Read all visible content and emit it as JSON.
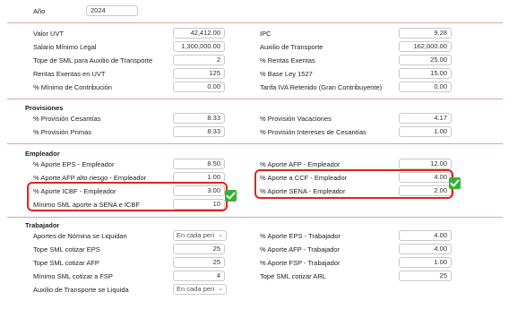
{
  "year": {
    "label": "Año",
    "value": "2024"
  },
  "general": {
    "left": [
      {
        "label": "Valor UVT",
        "value": "42,412.00"
      },
      {
        "label": "Salario Mínimo Legal",
        "value": "1,300,000.00"
      },
      {
        "label": "Tope de SML para Auxilio de Transporte",
        "value": "2"
      },
      {
        "label": "Rentas Exentas en UVT",
        "value": "125"
      },
      {
        "label": "% Mínimo de Contribución",
        "value": "0.00"
      }
    ],
    "right": [
      {
        "label": "IPC",
        "value": "9.28"
      },
      {
        "label": "Auxilio de Transporte",
        "value": "162,000.00"
      },
      {
        "label": "% Rentas Exentas",
        "value": "25.00"
      },
      {
        "label": "% Base Ley 1527",
        "value": "15.00"
      },
      {
        "label": "Tarifa IVA Retenido (Gran Contribuyente)",
        "value": "0.00"
      }
    ]
  },
  "provisiones": {
    "title": "Provisiones",
    "left": [
      {
        "label": "% Provisión Cesantías",
        "value": "8.33"
      },
      {
        "label": "% Provisión Primas",
        "value": "8.33"
      }
    ],
    "right": [
      {
        "label": "% Provisión Vacaciones",
        "value": "4.17"
      },
      {
        "label": "% Provisión Intereses de Cesantías",
        "value": "1.00"
      }
    ]
  },
  "empleador": {
    "title": "Empleador",
    "left": [
      {
        "label": "% Aporte EPS - Empleador",
        "value": "8.50"
      },
      {
        "label": "% Aporte AFP alto riesgo - Empleador",
        "value": "1.00"
      },
      {
        "label": "% Aporte ICBF - Empleador",
        "value": "3.00"
      },
      {
        "label": "Mínimo SML aporte a SENA e ICBF",
        "value": "10"
      }
    ],
    "right": [
      {
        "label": "% Aporte AFP - Empleador",
        "value": "12.00"
      },
      {
        "label": "% Aporte a CCF - Empleador",
        "value": "4.00"
      },
      {
        "label": "% Aporte SENA - Empleador",
        "value": "2.00"
      }
    ]
  },
  "trabajador": {
    "title": "Trabajador",
    "left": [
      {
        "label": "Aportes de Nómina se Liquidan",
        "value": "En cada peri"
      },
      {
        "label": "Tope SML cotizar EPS",
        "value": "25"
      },
      {
        "label": "Tope SML cotizar AFP",
        "value": "25"
      },
      {
        "label": "Mínimo SML cotizar a FSP",
        "value": "4"
      },
      {
        "label": "Auxilio de Transporte se Liquida",
        "value": "En cada peri"
      }
    ],
    "right": [
      {
        "label": "% Aporte EPS - Trabajador",
        "value": "4.00"
      },
      {
        "label": "% Aporte AFP - Trabajador",
        "value": "4.00"
      },
      {
        "label": "% Aporte FSP - Trabajador",
        "value": "1.00"
      },
      {
        "label": "Tope SML cotizar ARL",
        "value": "25"
      }
    ]
  },
  "icons": {
    "dropdown": "chevron-down-icon",
    "check": "check-icon"
  },
  "colors": {
    "highlight": "#e0241b",
    "check": "#34b233",
    "separator": "#d8a4a4"
  }
}
